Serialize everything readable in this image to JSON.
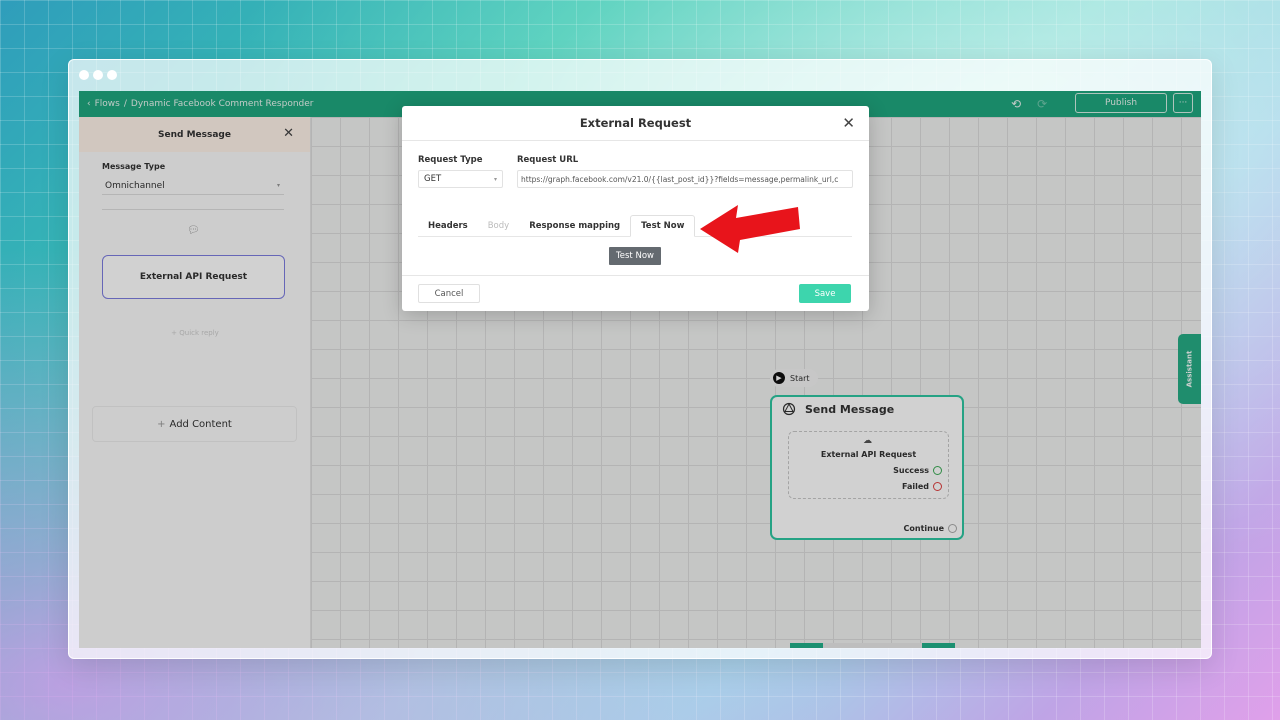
{
  "app": {
    "breadcrumb": {
      "back_label": "Flows",
      "separator": "/",
      "current": "Dynamic Facebook Comment Responder"
    },
    "publish_label": "Publish",
    "more_label": "···",
    "assistant_label": "Assistant"
  },
  "sidebar": {
    "title": "Send Message",
    "message_type_label": "Message Type",
    "message_type_value": "Omnichannel",
    "content_card_label": "External API Request",
    "quick_reply_label": "+ Quick reply",
    "add_content_label": "Add Content"
  },
  "canvas": {
    "start_label": "Start",
    "node": {
      "title": "Send Message",
      "inner_title": "External API Request",
      "success_label": "Success",
      "failed_label": "Failed",
      "continue_label": "Continue"
    }
  },
  "modal": {
    "title": "External Request",
    "request_type_label": "Request Type",
    "request_type_value": "GET",
    "request_url_label": "Request URL",
    "request_url_value": "https://graph.facebook.com/v21.0/{{last_post_id}}?fields=message,permalink_url,c",
    "tabs": [
      {
        "label": "Headers",
        "state": "normal"
      },
      {
        "label": "Body",
        "state": "disabled"
      },
      {
        "label": "Response mapping",
        "state": "normal"
      },
      {
        "label": "Test Now",
        "state": "active"
      }
    ],
    "test_now_button": "Test Now",
    "cancel_label": "Cancel",
    "save_label": "Save"
  },
  "colors": {
    "brand_green": "#1fa87f",
    "save_green": "#3dd5ad",
    "node_border": "#2ec6a2",
    "annotation_arrow": "#e8141b"
  },
  "icons": [
    "chevron-left-icon",
    "undo-icon",
    "redo-icon",
    "close-icon",
    "chat-bubble-icon",
    "plus-icon",
    "play-icon",
    "openai-icon",
    "cloud-upload-icon",
    "eye-icon",
    "zoom-in-icon",
    "zoom-out-icon",
    "fit-view-icon",
    "chevron-down-icon"
  ]
}
